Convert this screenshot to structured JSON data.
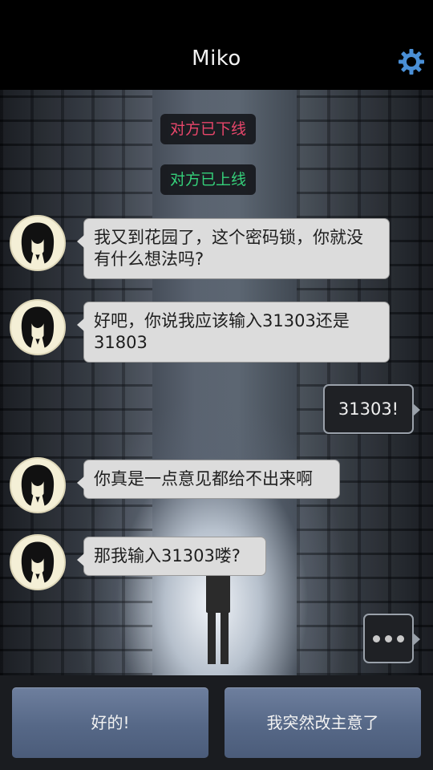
{
  "header": {
    "title": "Miko"
  },
  "notices": {
    "offline": "对方已下线",
    "online": "对方已上线"
  },
  "messages": [
    {
      "from": "npc",
      "text": "我又到花园了，这个密码锁，你就没有什么想法吗?"
    },
    {
      "from": "npc",
      "text": "好吧，你说我应该输入31303还是31803"
    },
    {
      "from": "player",
      "text": "31303!"
    },
    {
      "from": "npc",
      "text": "你真是一点意见都给不出来啊"
    },
    {
      "from": "npc",
      "text": "那我输入31303喽?"
    }
  ],
  "replies": {
    "option_a": "好的!",
    "option_b": "我突然改主意了"
  },
  "icons": {
    "settings": "gear-icon",
    "typing": "typing-indicator-icon"
  },
  "colors": {
    "offline": "#e8466a",
    "online": "#35d07a",
    "gear": "#4a8fd6"
  }
}
